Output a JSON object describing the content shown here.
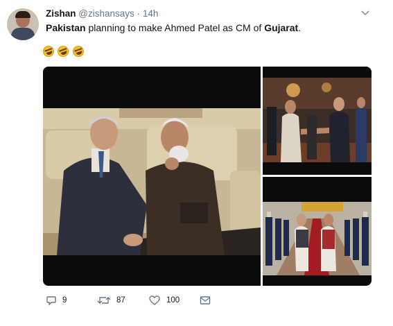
{
  "user": {
    "name": "Zishan",
    "handle": "@zishansays",
    "separator": "·",
    "time": "14h"
  },
  "tweet": {
    "text_parts": [
      "Pakistan",
      " planning to make Ahmed Patel as CM of ",
      "Gujarat",
      "."
    ],
    "emoji_icons": [
      "rolling-on-floor-laughing-icon",
      "rolling-on-floor-laughing-icon",
      "rolling-on-floor-laughing-icon"
    ]
  },
  "media": {
    "photos": [
      "photo-main-meeting",
      "photo-handshake",
      "photo-guard-of-honour"
    ]
  },
  "actions": {
    "reply_count": "9",
    "retweet_count": "87",
    "like_count": "100"
  },
  "colors": {
    "text": "#14171a",
    "secondary": "#657786",
    "background": "#ffffff"
  }
}
